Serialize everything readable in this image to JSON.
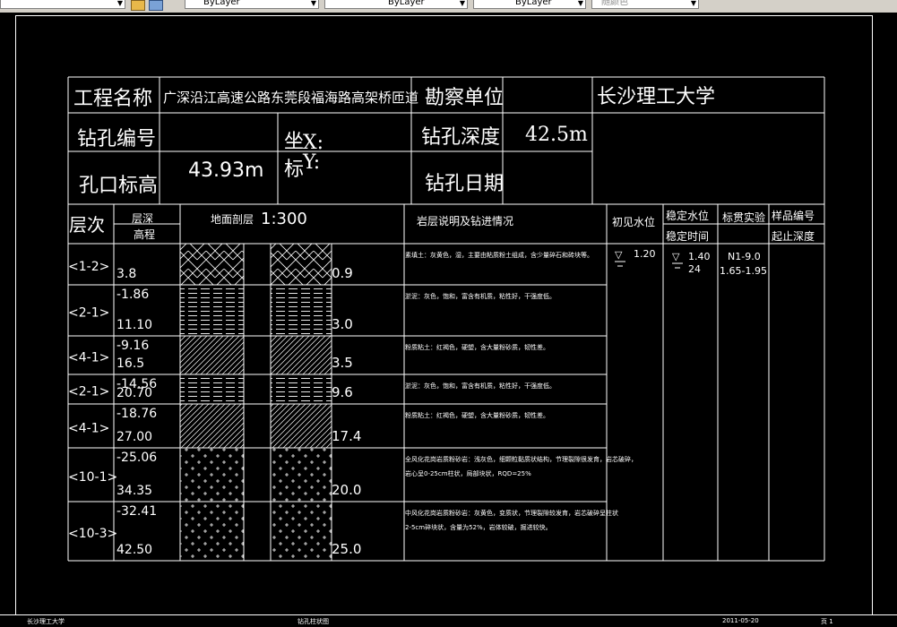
{
  "toolbar": {
    "layer_values": [
      "ByLayer",
      "ByLayer",
      "ByLayer"
    ],
    "color_value": "随颜色"
  },
  "header": {
    "project_name_label": "工程名称",
    "project_name": "广深沿江高速公路东莞段福海路高架桥匝道",
    "survey_unit_label": "勘察单位",
    "survey_unit": "长沙理工大学",
    "hole_no_label": "钻孔编号",
    "coord_label_top": "坐",
    "coord_label_bottom": "标",
    "coord_x": "X:",
    "coord_y": "Y:",
    "hole_depth_label": "钻孔深度",
    "hole_depth": "42.5m",
    "elevation_label": "孔口标高",
    "elevation": "43.93m",
    "date_label": "钻孔日期"
  },
  "columns": {
    "layer_no": "层次",
    "layer_depth": "层深",
    "layer_elev": "高程",
    "profile": "地面剖层",
    "scale": "1:300",
    "description": "岩层说明及钻进情况",
    "initial_water": "初见水位",
    "stable_water": "稳定水位",
    "stable_time": "稳定时间",
    "spt": "标贯实验",
    "sample_no": "样品编号",
    "sample_depth": "起止深度"
  },
  "layers": [
    {
      "no": "<1-2>",
      "top": "",
      "elev": "3.8",
      "depth": "0.9",
      "pattern": "hatch-herring",
      "desc": [
        "素填土：灰黄色，湿，主要由粘质粉土组成，含少量碎石和砖块等。"
      ]
    },
    {
      "no": "<2-1>",
      "top": "-1.86",
      "elev": "11.10",
      "depth": "3.0",
      "pattern": "hatch-dash",
      "desc": [
        "淤泥：灰色，饱和，富含有机质，粘性好，干强度低。"
      ]
    },
    {
      "no": "<4-1>",
      "top": "-9.16",
      "elev": "16.5",
      "depth": "3.5",
      "pattern": "hatch-diag",
      "desc": [
        "粉质粘土：红褐色，硬塑，含大量粉砂质，韧性差。"
      ]
    },
    {
      "no": "<2-1>",
      "top": "-14.56",
      "elev": "20.70",
      "depth": "9.6",
      "pattern": "hatch-dash",
      "desc": [
        "淤泥：灰色，饱和，富含有机质，粘性好，干强度低。"
      ]
    },
    {
      "no": "<4-1>",
      "top": "-18.76",
      "elev": "27.00",
      "depth": "17.4",
      "pattern": "hatch-diag",
      "desc": [
        "粉质粘土：红褐色，硬塑，含大量粉砂质，韧性差。"
      ]
    },
    {
      "no": "<10-1>",
      "top": "-25.06",
      "elev": "34.35",
      "depth": "20.0",
      "pattern": "hatch-plus",
      "desc": [
        "全风化花岗岩质粉砂岩：浅灰色，细颗粒黏质状结构，节理裂隙很发育，岩芯破碎，",
        "岩心呈0-25cm柱状，局部块状，RQD=25%"
      ]
    },
    {
      "no": "<10-3>",
      "top": "-32.41",
      "elev": "42.50",
      "depth": "25.0",
      "pattern": "hatch-plus",
      "desc": [
        "中风化花岗岩质粉砂岩：灰黄色，变质状，节理裂隙较发育，岩芯破碎呈柱状",
        "2-5cm碎块状，含量为52%，岩体较破，掘进较快。"
      ]
    }
  ],
  "water": {
    "initial": "1.20",
    "stable": "1.40",
    "stable_time": "24"
  },
  "spt": {
    "id": "N1-9.0",
    "range": "1.65-1.95"
  },
  "statusbar": {
    "left_text": "长沙理工大学",
    "center_text": "钻孔柱状图",
    "date_text": "2011-05-20",
    "page_text": "页 1"
  }
}
